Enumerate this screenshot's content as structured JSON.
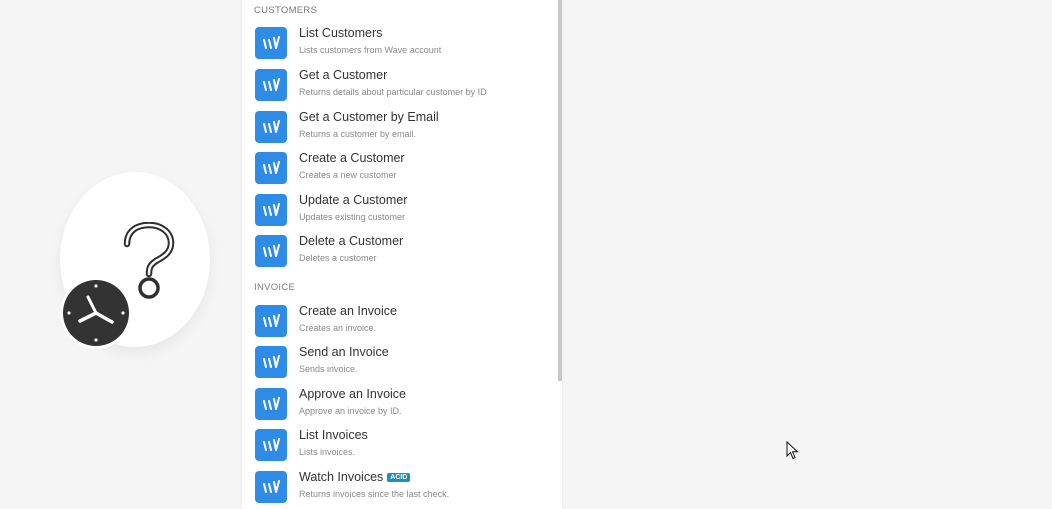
{
  "canvas": {
    "placeholder_module": {
      "icon": "question-icon",
      "trigger_icon": "clock-icon"
    }
  },
  "panel": {
    "sections": [
      {
        "header": "CUSTOMERS",
        "items": [
          {
            "title": "List Customers",
            "description": "Lists customers from Wave account"
          },
          {
            "title": "Get a Customer",
            "description": "Returns details about particular customer by ID"
          },
          {
            "title": "Get a Customer by Email",
            "description": "Returns a customer by email."
          },
          {
            "title": "Create a Customer",
            "description": "Creates a new customer"
          },
          {
            "title": "Update a Customer",
            "description": "Updates existing customer"
          },
          {
            "title": "Delete a Customer",
            "description": "Deletes a customer"
          }
        ]
      },
      {
        "header": "INVOICE",
        "items": [
          {
            "title": "Create an Invoice",
            "description": "Creates an invoice."
          },
          {
            "title": "Send an Invoice",
            "description": "Sends invoice."
          },
          {
            "title": "Approve an Invoice",
            "description": "Approve an invoice by ID."
          },
          {
            "title": "List Invoices",
            "description": "Lists invoices."
          },
          {
            "title": "Watch Invoices",
            "badge": "ACID",
            "description": "Returns invoices since the last check."
          }
        ]
      }
    ],
    "item_icon": "wave-icon"
  },
  "colors": {
    "icon_bg": "#2e8ce6",
    "badge_bg": "#1e8fbd",
    "canvas_bg": "#f5f5f5"
  }
}
